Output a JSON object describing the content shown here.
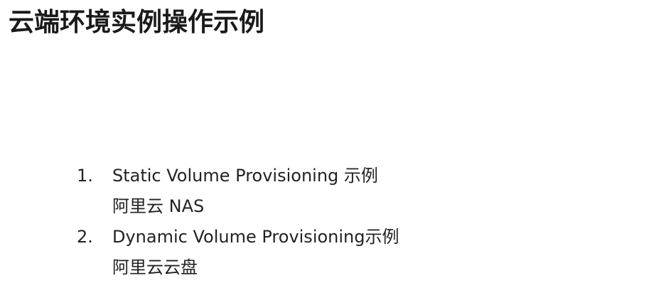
{
  "slide": {
    "title": "云端环境实例操作示例",
    "items": [
      {
        "number": "1.",
        "title": "Static Volume Provisioning 示例",
        "subtitle": "阿里云 NAS"
      },
      {
        "number": "2.",
        "title": "Dynamic Volume Provisioning示例",
        "subtitle": "阿里云云盘"
      }
    ]
  }
}
